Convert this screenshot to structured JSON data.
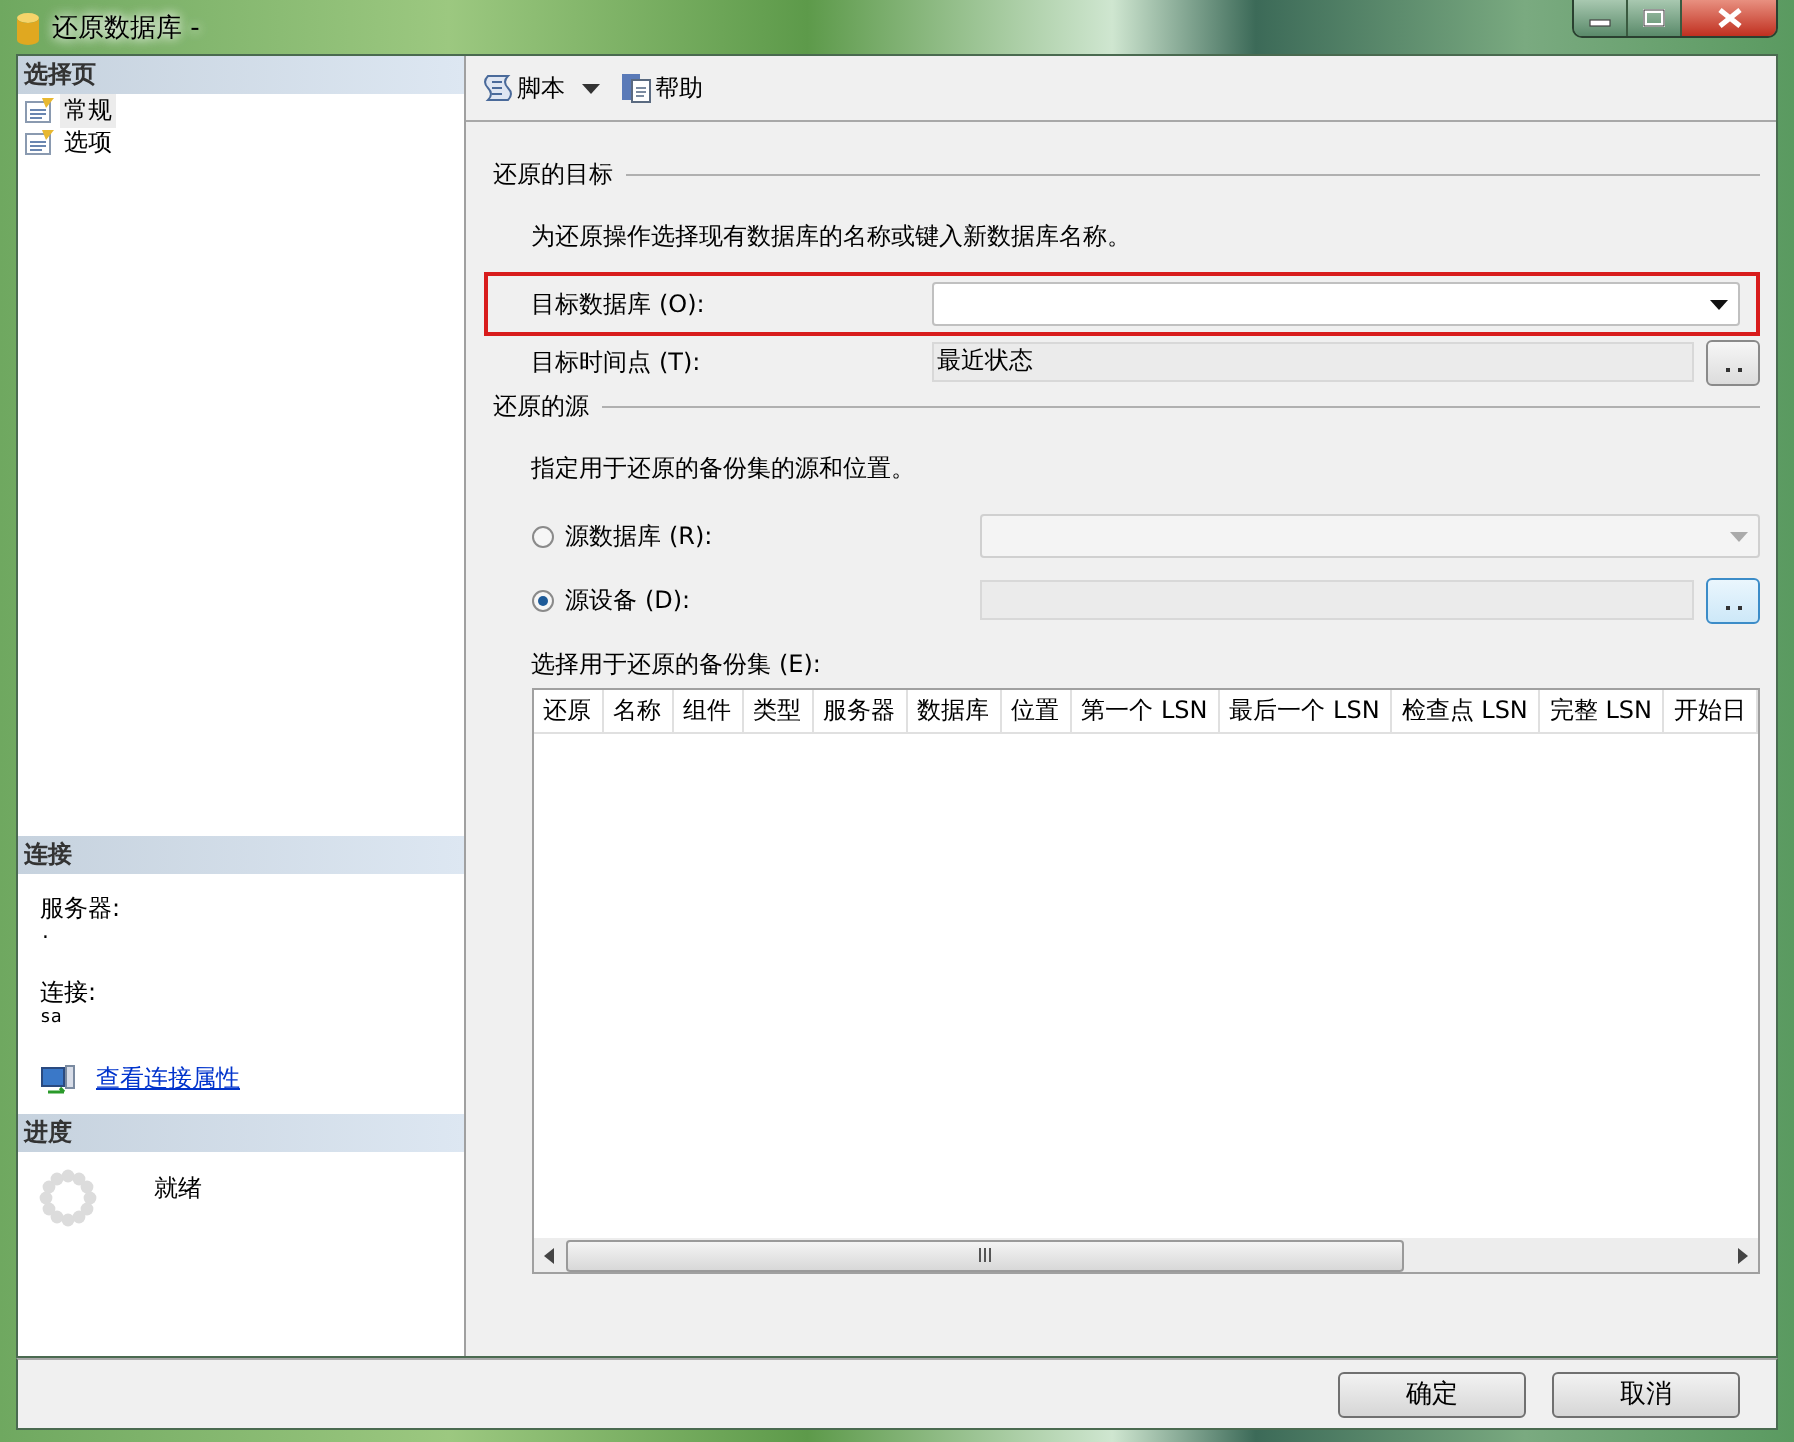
{
  "window": {
    "title": "还原数据库 -"
  },
  "sidebar": {
    "header": "选择页",
    "items": [
      {
        "label": "常规",
        "selected": true
      },
      {
        "label": "选项",
        "selected": false
      }
    ]
  },
  "connection": {
    "header": "连接",
    "fields": [
      {
        "label": "服务器:",
        "value": "."
      },
      {
        "label": "连接:",
        "value": "sa"
      }
    ],
    "link": "查看连接属性"
  },
  "progress": {
    "header": "进度",
    "status": "就绪"
  },
  "toolbar": [
    {
      "label": "脚本",
      "kind": "script"
    },
    {
      "label": "帮助",
      "kind": "help"
    }
  ],
  "destination": {
    "title": "还原的目标",
    "hint": "为还原操作选择现有数据库的名称或键入新数据库名称。",
    "rows": [
      {
        "label": "目标数据库 (O):",
        "kind": "combo",
        "highlighted": true
      },
      {
        "label": "目标时间点 (T):",
        "kind": "browse",
        "value": "最近状态",
        "highlighted": false
      }
    ]
  },
  "source": {
    "title": "还原的源",
    "hint": "指定用于还原的备份集的源和位置。",
    "options": [
      {
        "label": "源数据库 (R):",
        "kind": "combo",
        "selected": false
      },
      {
        "label": "源设备 (D):",
        "kind": "browse",
        "selected": true
      }
    ]
  },
  "backup_sets": {
    "label": "选择用于还原的备份集 (E):",
    "columns": [
      "还原",
      "名称",
      "组件",
      "类型",
      "服务器",
      "数据库",
      "位置",
      "第一个 LSN",
      "最后一个 LSN",
      "检查点 LSN",
      "完整 LSN",
      "开始日"
    ]
  },
  "buttons": [
    "确定",
    "取消"
  ]
}
